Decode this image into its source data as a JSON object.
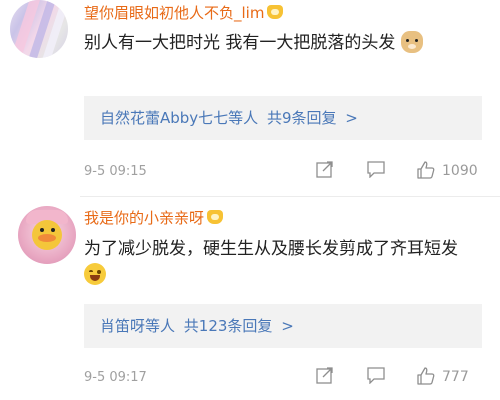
{
  "comments": [
    {
      "username": "望你眉眼如初他人不负_lim",
      "text": "别人有一大把时光  我有一大把脱落的头发",
      "replies": {
        "names": "自然花蕾Abby七七等人",
        "count": "共9条回复",
        "arrow": ">"
      },
      "time": "9-5 09:15",
      "likes": "1090",
      "emoji": "dog-face-icon"
    },
    {
      "username": "我是你的小亲亲呀",
      "text": "为了减少脱发，硬生生从及腰长发剪成了齐耳短发",
      "replies": {
        "names": "肖笛呀等人",
        "count": "共123条回复",
        "arrow": ">"
      },
      "time": "9-5 09:17",
      "likes": "777",
      "emoji": "laughing-face-icon"
    }
  ],
  "colors": {
    "username": "#e86a17",
    "link": "#4a78b8",
    "meta": "#a0a0a0"
  }
}
